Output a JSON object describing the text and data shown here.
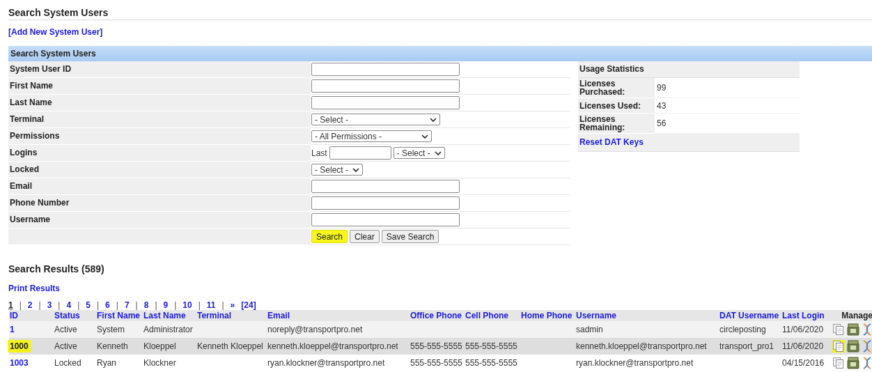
{
  "page_title": "Search System Users",
  "add_link": "[Add New System User]",
  "search_panel": {
    "title": "Search System Users",
    "fields": [
      {
        "label": "System User ID",
        "kind": "text"
      },
      {
        "label": "First Name",
        "kind": "text"
      },
      {
        "label": "Last Name",
        "kind": "text"
      },
      {
        "label": "Terminal",
        "kind": "select",
        "value": "- Select -"
      },
      {
        "label": "Permissions",
        "kind": "select",
        "value": "- All Permissions -"
      },
      {
        "label": "Logins",
        "kind": "range",
        "prefix": "Last",
        "value": "- Select -"
      },
      {
        "label": "Locked",
        "kind": "select",
        "value": "- Select -"
      },
      {
        "label": "Email",
        "kind": "text"
      },
      {
        "label": "Phone Number",
        "kind": "text"
      },
      {
        "label": "Username",
        "kind": "text"
      }
    ],
    "buttons": [
      {
        "label": "Search",
        "highlighted": true
      },
      {
        "label": "Clear",
        "highlighted": false
      },
      {
        "label": "Save Search",
        "highlighted": false
      }
    ]
  },
  "usage_statistics": {
    "title": "Usage Statistics",
    "rows": [
      {
        "label": "Licenses Purchased:",
        "value": "99"
      },
      {
        "label": "Licenses Used:",
        "value": "43"
      },
      {
        "label": "Licenses Remaining:",
        "value": "56"
      }
    ],
    "link": "Reset DAT Keys"
  },
  "results": {
    "title": "Search Results (589)",
    "print_link": "Print Results",
    "pager": {
      "separator": "|",
      "pages": [
        {
          "label": "1",
          "selected": true
        },
        {
          "label": "2",
          "selected": false
        },
        {
          "label": "3",
          "selected": false
        },
        {
          "label": "4",
          "selected": false
        },
        {
          "label": "5",
          "selected": false
        },
        {
          "label": "6",
          "selected": false
        },
        {
          "label": "7",
          "selected": false
        },
        {
          "label": "8",
          "selected": false
        },
        {
          "label": "9",
          "selected": false
        },
        {
          "label": "10",
          "selected": false
        },
        {
          "label": "11",
          "selected": false
        }
      ],
      "next": "»",
      "last": "[24]"
    },
    "columns": [
      {
        "label": "ID",
        "sortable": true
      },
      {
        "label": "Status",
        "sortable": true
      },
      {
        "label": "First Name",
        "sortable": true
      },
      {
        "label": "Last Name",
        "sortable": true
      },
      {
        "label": "Terminal",
        "sortable": true
      },
      {
        "label": "Email",
        "sortable": true
      },
      {
        "label": "Office Phone",
        "sortable": true
      },
      {
        "label": "Cell Phone",
        "sortable": true
      },
      {
        "label": "Home Phone",
        "sortable": true
      },
      {
        "label": "Username",
        "sortable": true
      },
      {
        "label": "DAT Username",
        "sortable": true
      },
      {
        "label": "Last Login",
        "sortable": true
      },
      {
        "label": "Manage",
        "sortable": false
      }
    ],
    "rows": [
      {
        "id": "1",
        "id_highlighted": false,
        "status": "Active",
        "first_name": "System",
        "last_name": "Administrator",
        "email": "noreply@transportpro.net",
        "username": "sadmin",
        "dat_username": "circleposting",
        "last_login": "11/06/2020",
        "manage_highlighted": false
      },
      {
        "id": "1000",
        "id_highlighted": true,
        "status": "Active",
        "first_name": "Kenneth",
        "last_name": "Kloeppel",
        "terminal": "Kenneth Kloeppel",
        "email": "kenneth.kloeppel@transportpro.net",
        "office_phone": "555-555-5555",
        "cell_phone": "555-555-5555",
        "username": "kenneth.kloeppel@transportpro.net",
        "dat_username": "transport_pro1",
        "last_login": "11/06/2020",
        "manage_highlighted": true
      },
      {
        "id": "1003",
        "id_highlighted": false,
        "status": "Locked",
        "first_name": "Ryan",
        "last_name": "Klockner",
        "email": "ryan.klockner@transportpro.net",
        "office_phone": "555-555-5555",
        "cell_phone": "555-555-5555",
        "username": "ryan.klockner@transportpro.net",
        "last_login": "04/15/2016",
        "manage_highlighted": false
      }
    ]
  }
}
